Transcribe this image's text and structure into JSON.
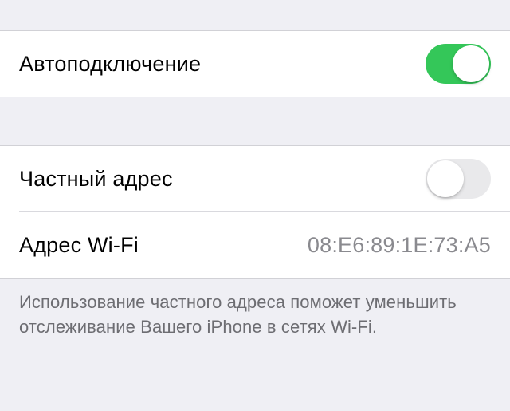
{
  "section1": {
    "autojoin": {
      "label": "Автоподключение",
      "on": true
    }
  },
  "section2": {
    "privateAddress": {
      "label": "Частный адрес",
      "on": false
    },
    "wifiAddress": {
      "label": "Адрес Wi-Fi",
      "value": "08:E6:89:1E:73:A5"
    },
    "footer": "Использование частного адреса поможет уменьшить отслеживание Вашего iPhone в сетях Wi-Fi."
  }
}
